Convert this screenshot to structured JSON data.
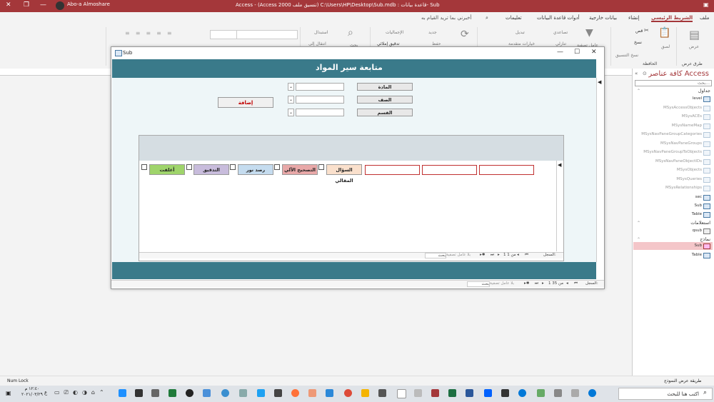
{
  "titlebar": {
    "text": "Access - (Access 2000 تنسيق ملف) C:\\Users\\HP\\Desktop\\Sub.mdb : قاعدة بيانات- Sub",
    "user": "Abo-a Almoshare"
  },
  "menu": {
    "items": [
      "ملف",
      "الشريط الرئيسي",
      "إنشاء",
      "بيانات خارجية",
      "أدوات قاعدة البيانات",
      "تعليمات",
      "أخبرني بما تريد القيام به"
    ],
    "active_index": 1
  },
  "ribbon": {
    "groups": {
      "views": "طرق عرض",
      "clipboard": "الحافظة"
    },
    "labels": {
      "cut": "قص",
      "copy": "نسخ",
      "paste": "لصق",
      "format_painter": "نسخ التنسيق",
      "view": "عرض",
      "filter": "عامل تصفية",
      "ascending": "تصاعدي",
      "descending": "تنازلي",
      "advanced": "خيارات متقدمة",
      "toggle_filter": "تبديل",
      "refresh": "تحديث",
      "new": "جديد",
      "save": "حفظ",
      "totals": "الإجماليات",
      "spelling": "تدقيق إملائي",
      "find": "بحث",
      "replace": "استبدال",
      "goto": "انتقال إلى",
      "select": "تحديد"
    }
  },
  "navpane": {
    "title": "كافة عناصر Access",
    "search_placeholder": "بحث...",
    "groups": {
      "tables": "جداول",
      "queries": "استعلامات",
      "forms": "نماذج"
    },
    "tables": [
      {
        "name": "level",
        "dim": false
      },
      {
        "name": "MSysAccessObjects",
        "dim": true
      },
      {
        "name": "MSysACEs",
        "dim": true
      },
      {
        "name": "MSysNameMap",
        "dim": true
      },
      {
        "name": "MSysNavPaneGroupCategories",
        "dim": true
      },
      {
        "name": "MSysNavPaneGroups",
        "dim": true
      },
      {
        "name": "MSysNavPaneGroupToObjects",
        "dim": true
      },
      {
        "name": "MSysNavPaneObjectIDs",
        "dim": true
      },
      {
        "name": "MSysObjects",
        "dim": true
      },
      {
        "name": "MSysQueries",
        "dim": true
      },
      {
        "name": "MSysRelationships",
        "dim": true
      },
      {
        "name": "sec",
        "dim": false
      },
      {
        "name": "Sub",
        "dim": false
      },
      {
        "name": "Table",
        "dim": false
      }
    ],
    "queries": [
      {
        "name": "qsub"
      }
    ],
    "forms": [
      {
        "name": "Sub",
        "selected": true
      },
      {
        "name": "Table",
        "selected": false
      }
    ]
  },
  "form": {
    "window_title": "Sub",
    "header_title": "متابعة سير المواد",
    "labels": {
      "subject": "المادة",
      "grade": "الصف",
      "section": "القسم"
    },
    "add_button": "إضافة",
    "tags": [
      "السؤال المقالي",
      "التصحيح الآلي",
      "رصد نور",
      "التدقيق",
      "أغلقت"
    ],
    "sub_nav": {
      "record_label": "السجل:",
      "position": "1 من 1",
      "filter": "بلا عامل تصفية",
      "search": "بحث"
    },
    "main_nav": {
      "record_label": "السجل:",
      "position": "1 من 35",
      "filter": "بلا عامل تصفية",
      "search": "بحث"
    }
  },
  "statusbar": {
    "left": "Num Lock",
    "right": "طريقة عرض النموذج"
  },
  "taskbar": {
    "search_placeholder": "اكتب هنا للبحث",
    "time": "١٢:٤٠ م",
    "date": "٢٠٢١/٠٣/٢٩"
  }
}
